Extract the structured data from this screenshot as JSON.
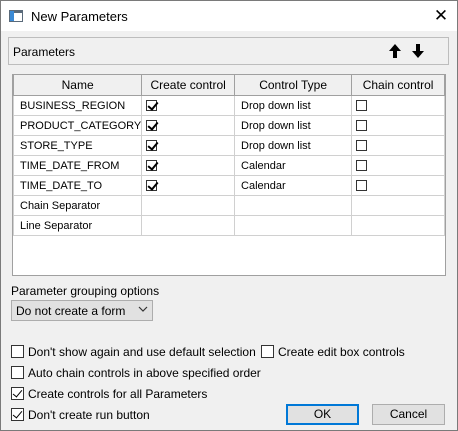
{
  "window": {
    "title": "New Parameters",
    "close_glyph": "✕"
  },
  "parameters_section": {
    "label": "Parameters",
    "move_up_icon": "arrow-up-icon",
    "move_down_icon": "arrow-down-icon"
  },
  "grid": {
    "headers": [
      "Name",
      "Create control",
      "Control Type",
      "Chain control"
    ],
    "rows": [
      {
        "name": "BUSINESS_REGION",
        "create_control": true,
        "control_type": "Drop down list",
        "chain_control": false
      },
      {
        "name": "PRODUCT_CATEGORY",
        "create_control": true,
        "control_type": "Drop down list",
        "chain_control": false
      },
      {
        "name": "STORE_TYPE",
        "create_control": true,
        "control_type": "Drop down list",
        "chain_control": false
      },
      {
        "name": "TIME_DATE_FROM",
        "create_control": true,
        "control_type": "Calendar",
        "chain_control": false
      },
      {
        "name": "TIME_DATE_TO",
        "create_control": true,
        "control_type": "Calendar",
        "chain_control": false
      },
      {
        "name": "Chain Separator",
        "create_control": null,
        "control_type": "",
        "chain_control": null
      },
      {
        "name": "Line Separator",
        "create_control": null,
        "control_type": "",
        "chain_control": null
      }
    ]
  },
  "grouping": {
    "label": "Parameter grouping options",
    "selected": "Do not create a form"
  },
  "options": {
    "dont_show_again": {
      "label": "Don't show again and use default selection",
      "checked": false
    },
    "create_edit_box": {
      "label": "Create edit box controls",
      "checked": false
    },
    "auto_chain": {
      "label": "Auto chain controls in above specified order",
      "checked": false
    },
    "create_all": {
      "label": "Create controls for all Parameters",
      "checked": true
    },
    "dont_run_button": {
      "label": "Don't create run button",
      "checked": true
    }
  },
  "buttons": {
    "ok": "OK",
    "cancel": "Cancel"
  },
  "colors": {
    "accent": "#0078d7",
    "panel": "#f0f0f0",
    "button": "#e1e1e1"
  }
}
